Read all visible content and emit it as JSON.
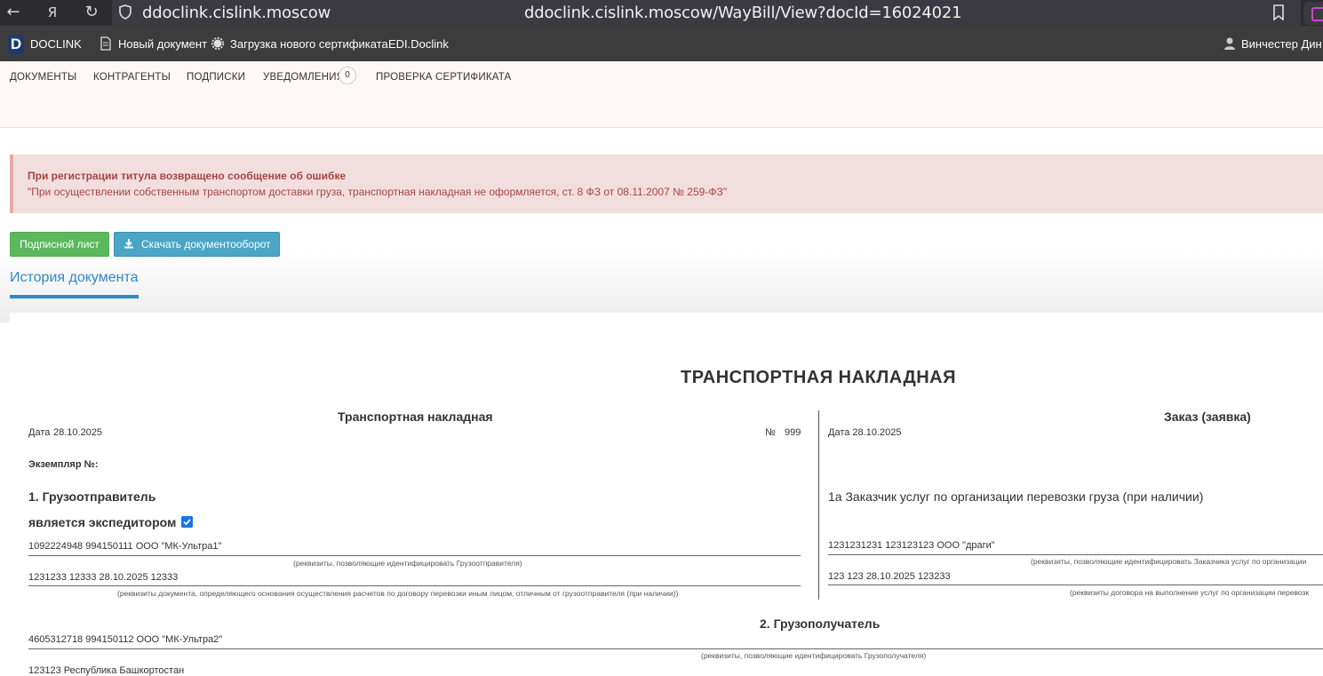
{
  "browser": {
    "host": "ddoclink.cislink.moscow",
    "url": "ddoclink.cislink.moscow/WayBill/View?docId=16024021"
  },
  "app_bar": {
    "logo_letter": "D",
    "brand": "DOCLINK",
    "new_doc": "Новый документ",
    "upload_cert": "Загрузка нового сертификата",
    "edi": "EDI.Doclink",
    "user": "Винчестер Дин ["
  },
  "nav": {
    "documents": "ДОКУМЕНТЫ",
    "contractors": "КОНТРАГЕНТЫ",
    "subscriptions": "ПОДПИСКИ",
    "notifications": "УВЕДОМЛЕНИЯ",
    "notifications_count": "0",
    "cert_check": "ПРОВЕРКА СЕРТИФИКАТА"
  },
  "alert": {
    "title": "При регистрации титула возвращено сообщение об ошибке",
    "message": "\"При осуществлении собственным транспортом доставки груза, транспортная накладная не оформляется, ст. 8 ФЗ от 08.11.2007 № 259-ФЗ\""
  },
  "buttons": {
    "sign_sheet": "Подписной лист",
    "download_flow": "Скачать документооборот"
  },
  "tabs": {
    "history": "История документа"
  },
  "document": {
    "title": "ТРАНСПОРТНАЯ НАКЛАДНАЯ",
    "left": {
      "heading": "Транспортная накладная",
      "date_label": "Дата",
      "date": "28.10.2025",
      "num_label": "№",
      "num": "999",
      "copy_label": "Экземпляр №:",
      "section1": "1. Грузоотправитель",
      "expeditor": "является экспедитором",
      "shipper_value": "1092224948 994150111 ООО \"МК-Ультра1\"",
      "shipper_hint": "(реквизиты, позволяющие идентифицировать Грузоотправителя)",
      "basis_value": "1231233 12333 28.10.2025 12333",
      "basis_hint": "(реквизиты документа, определяющего основания осуществления расчетов по договору перевозки иным лицом, отличным от грузоотправителя (при наличии))"
    },
    "right": {
      "heading": "Заказ (заявка)",
      "date_line": "Дата 28.10.2025",
      "section1a": "1а Заказчик услуг по организации перевозки груза (при наличии)",
      "customer_value": "1231231231 123123123 ООО \"драги\"",
      "customer_hint": "(реквизиты, позволяющие идентифицировать Заказчика услуг по организации",
      "contract_value": "123 123 28.10.2025 123233",
      "contract_hint": "(реквизиты договора на выполнение услуг по организации перевозк"
    },
    "consignee": {
      "heading": "2. Грузополучатель",
      "value": "4605312718 994150112 ООО \"МК-Ультра2\"",
      "hint": "(реквизиты, позволяющие идентифицировать Грузополучателя)",
      "address": "123123 Республика Башкортостан"
    }
  }
}
